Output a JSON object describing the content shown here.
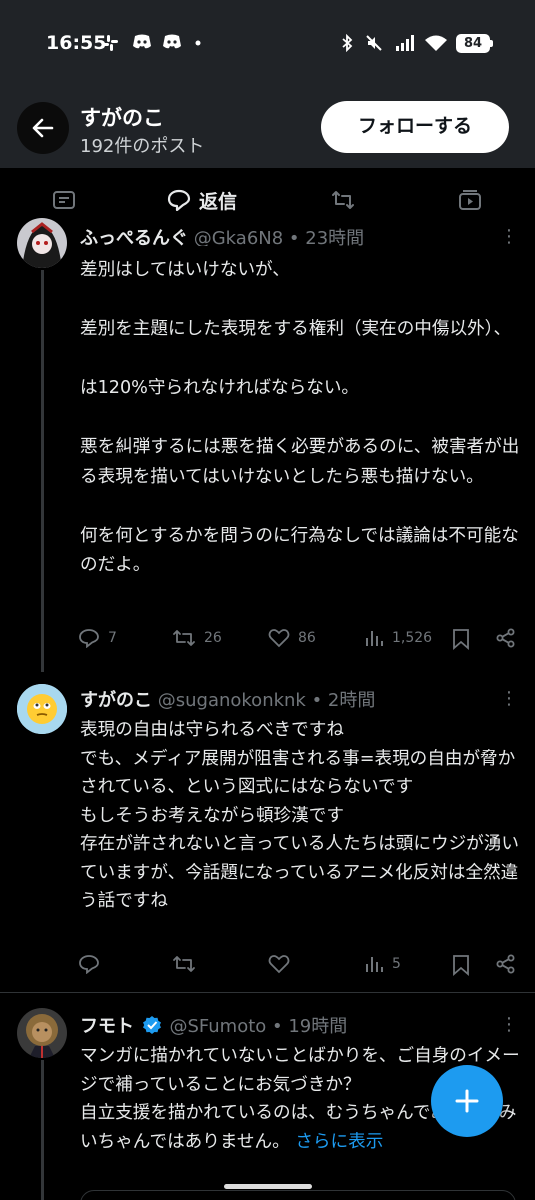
{
  "status_bar": {
    "time": "16:55",
    "battery": "84",
    "icons": [
      "slack-icon",
      "discord-icon",
      "discord-icon",
      "dot-icon",
      "bluetooth-icon",
      "mute-icon",
      "signal-icon",
      "wifi-icon"
    ]
  },
  "header": {
    "name": "すがのこ",
    "post_count": "192件のポスト",
    "follow_label": "フォローする"
  },
  "tabs": [
    {
      "icon": "list-icon",
      "label": ""
    },
    {
      "icon": "reply-icon",
      "label": "返信",
      "active": true
    },
    {
      "icon": "retweet-icon",
      "label": ""
    },
    {
      "icon": "media-icon",
      "label": ""
    }
  ],
  "posts": [
    {
      "name": "ふっぺるんぐ",
      "meta": "@Gka6N8 • 23時間",
      "text": "差別はしてはいけないが、\n\n差別を主題にした表現をする権利（実在の中傷以外）、\n\nは120%守られなければならない。\n\n悪を糾弾するには悪を描く必要があるのに、被害者が出る表現を描いてはいけないとしたら悪も描けない。\n\n何を何とするかを問うのに行為なしでは議論は不可能なのだよ。",
      "replies": "7",
      "retweets": "26",
      "likes": "86",
      "views": "1,526"
    },
    {
      "name": "すがのこ",
      "meta": "@suganokonknk • 2時間",
      "text": "表現の自由は守られるべきですね\nでも、メディア展開が阻害される事=表現の自由が脅かされている、という図式にはならないです\nもしそうお考えながら頓珍漢です\n存在が許されないと言っている人たちは頭にウジが湧いていますが、今話題になっているアニメ化反対は全然違う話ですね",
      "replies": "",
      "retweets": "",
      "likes": "",
      "views": "5"
    },
    {
      "name": "フモト",
      "meta": "@SFumoto • 19時間",
      "verified": true,
      "text": "マンガに描かれていないことばかりを、ご自身のイメージで補っていることにお気づきか？\n自立支援を描かれているのは、むうちゃんであって、みいちゃんではありません。",
      "show_more": "さらに表示"
    }
  ],
  "colors": {
    "accent": "#1d9bf0",
    "header_bg": "#202327",
    "muted_text": "#71767b"
  }
}
